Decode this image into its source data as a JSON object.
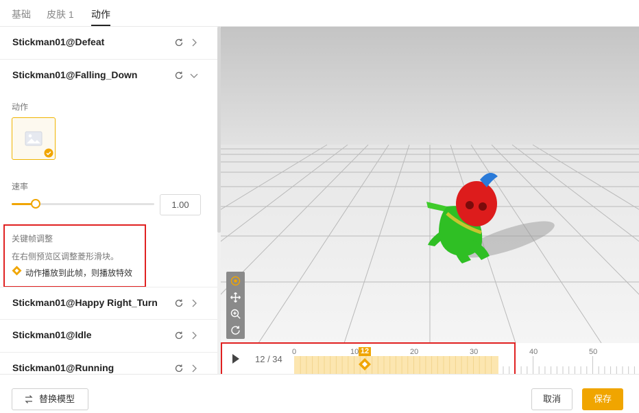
{
  "tabs": [
    {
      "label": "基础"
    },
    {
      "label": "皮肤 1"
    },
    {
      "label": "动作"
    }
  ],
  "animations": [
    {
      "name": "Stickman01@Defeat"
    },
    {
      "name": "Stickman01@Falling_Down"
    },
    {
      "name": "Stickman01@Happy Right_Turn"
    },
    {
      "name": "Stickman01@Idle"
    },
    {
      "name": "Stickman01@Running"
    }
  ],
  "expanded": {
    "action_label": "动作",
    "speed_label": "速率",
    "speed_value": "1.00",
    "speed_fraction": 0.17,
    "keyframe_title": "关键帧调整",
    "keyframe_hint": "在右侧预览区调整菱形滑块。",
    "keyframe_note": "动作播放到此帧，则播放特效"
  },
  "timeline": {
    "counter": "12 / 34",
    "current_frame": 12,
    "total_frames": 34,
    "ticks": [
      "0",
      "10",
      "20",
      "30",
      "40",
      "50"
    ]
  },
  "footer": {
    "replace_model": "替换模型",
    "cancel": "取消",
    "save": "保存"
  },
  "colors": {
    "accent": "#f0a500",
    "highlight": "#e02020"
  }
}
